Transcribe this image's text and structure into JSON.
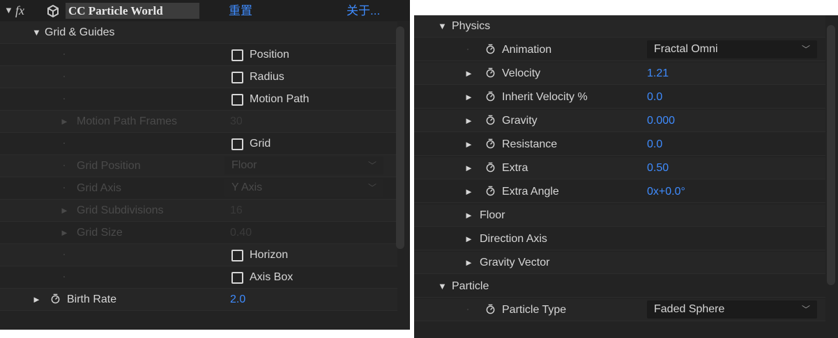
{
  "effect_header": {
    "fx_icon": "fx",
    "effect_name": "CC Particle World",
    "reset_label": "重置",
    "about_label": "关于..."
  },
  "grid_guides": {
    "label": "Grid & Guides",
    "position_label": "Position",
    "radius_label": "Radius",
    "motion_path_label": "Motion Path",
    "motion_path_frames_label": "Motion Path Frames",
    "motion_path_frames_value": "30",
    "grid_label": "Grid",
    "grid_position_label": "Grid Position",
    "grid_position_value": "Floor",
    "grid_axis_label": "Grid Axis",
    "grid_axis_value": "Y Axis",
    "grid_subdivisions_label": "Grid Subdivisions",
    "grid_subdivisions_value": "16",
    "grid_size_label": "Grid Size",
    "grid_size_value": "0.40",
    "horizon_label": "Horizon",
    "axis_box_label": "Axis Box"
  },
  "birth_rate": {
    "label": "Birth Rate",
    "value": "2.0"
  },
  "physics": {
    "label": "Physics",
    "animation_label": "Animation",
    "animation_value": "Fractal Omni",
    "velocity_label": "Velocity",
    "velocity_value": "1.21",
    "inherit_velocity_label": "Inherit Velocity %",
    "inherit_velocity_value": "0.0",
    "gravity_label": "Gravity",
    "gravity_value": "0.000",
    "resistance_label": "Resistance",
    "resistance_value": "0.0",
    "extra_label": "Extra",
    "extra_value": "0.50",
    "extra_angle_label": "Extra Angle",
    "extra_angle_value": "0x+0.0°",
    "floor_label": "Floor",
    "direction_axis_label": "Direction Axis",
    "gravity_vector_label": "Gravity Vector"
  },
  "particle": {
    "label": "Particle",
    "particle_type_label": "Particle Type",
    "particle_type_value": "Faded Sphere"
  },
  "icons": {
    "expand": "▼",
    "collapse": "►",
    "stopwatch": "stopwatch-icon",
    "checkbox": "checkbox-icon",
    "dropdown": "chevron-down-icon"
  },
  "colors": {
    "panel_bg": "#232323",
    "label": "#d6d6d6",
    "disabled": "#4a4a4a",
    "value_blue": "#3f8cff"
  }
}
